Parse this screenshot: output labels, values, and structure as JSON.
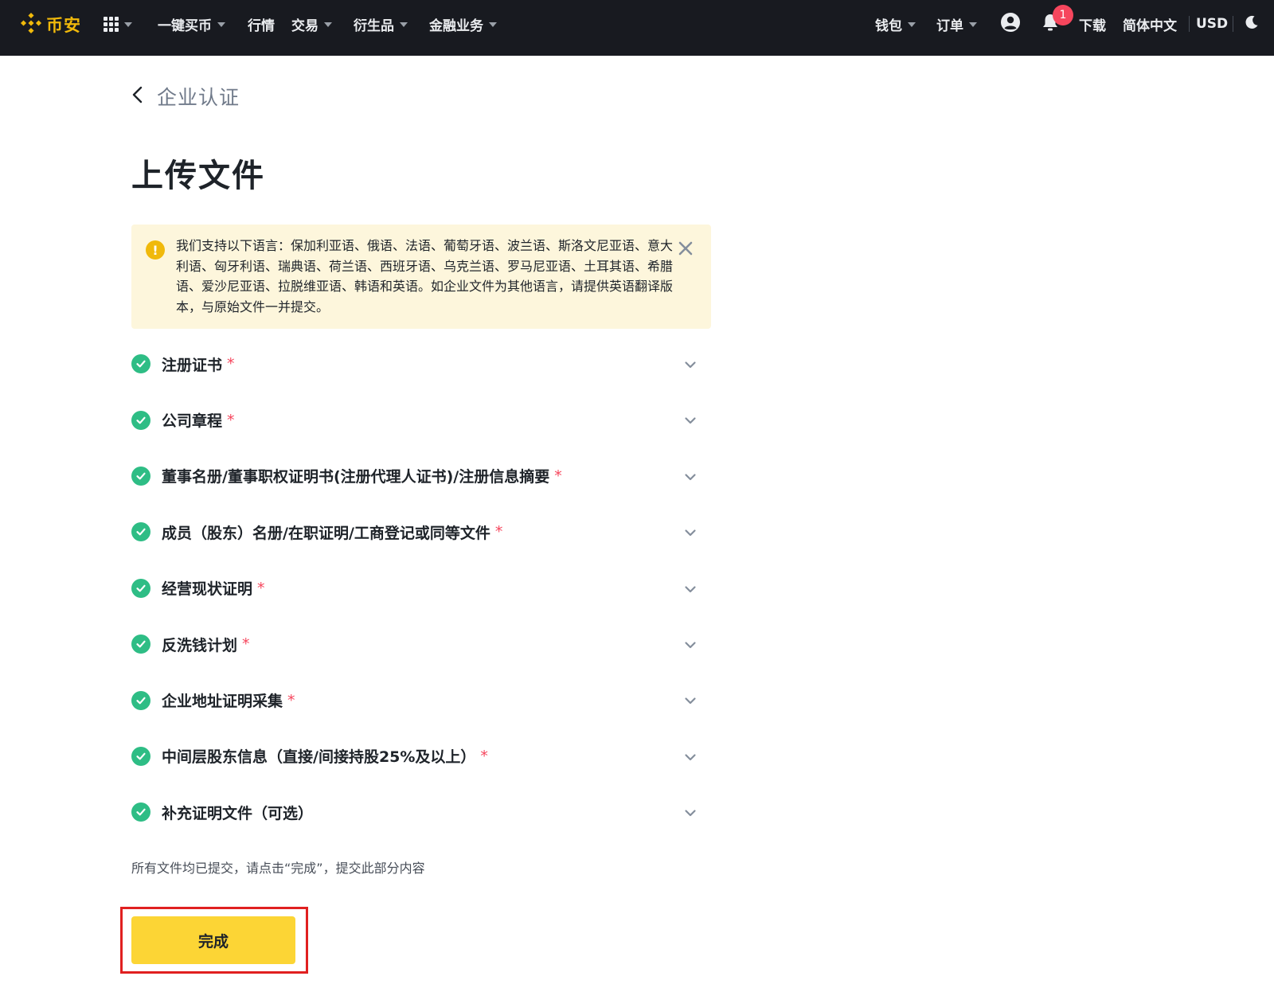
{
  "header": {
    "logo_text": "币安",
    "nav": [
      {
        "label": "一键买币",
        "has_dropdown": true
      },
      {
        "label": "行情",
        "has_dropdown": false
      },
      {
        "label": "交易",
        "has_dropdown": true
      },
      {
        "label": "衍生品",
        "has_dropdown": true
      },
      {
        "label": "金融业务",
        "has_dropdown": true
      }
    ],
    "right": {
      "wallet": "钱包",
      "orders": "订单",
      "notification_count": "1",
      "download": "下载",
      "language": "简体中文",
      "currency": "USD"
    }
  },
  "page": {
    "back_label": "企业认证",
    "title": "上传文件",
    "notice": "我们支持以下语言：保加利亚语、俄语、法语、葡萄牙语、波兰语、斯洛文尼亚语、意大利语、匈牙利语、瑞典语、荷兰语、西班牙语、乌克兰语、罗马尼亚语、土耳其语、希腊语、爱沙尼亚语、拉脱维亚语、韩语和英语。如企业文件为其他语言，请提供英语翻译版本，与原始文件一并提交。",
    "documents": [
      {
        "label": "注册证书",
        "required": "*"
      },
      {
        "label": "公司章程",
        "required": "*"
      },
      {
        "label": "董事名册/董事职权证明书(注册代理人证书)/注册信息摘要",
        "required": "*"
      },
      {
        "label": "成员（股东）名册/在职证明/工商登记或同等文件",
        "required": "*"
      },
      {
        "label": "经营现状证明",
        "required": "*"
      },
      {
        "label": "反洗钱计划",
        "required": "*"
      },
      {
        "label": "企业地址证明采集",
        "required": "*"
      },
      {
        "label": "中间层股东信息（直接/间接持股25%及以上）",
        "required": "*"
      },
      {
        "label": "补充证明文件（可选）",
        "required": ""
      }
    ],
    "hint": "所有文件均已提交，请点击“完成”，提交此部分内容",
    "done_button": "完成"
  },
  "colors": {
    "header_bg": "#181a20",
    "brand_yellow": "#f0b90b",
    "button_yellow": "#fcd535",
    "success_green": "#2ebd85",
    "required_red": "#f6465d",
    "notice_bg": "#fdf6dc"
  },
  "icons": [
    "binance-logo-icon",
    "apps-grid-icon",
    "user-icon",
    "bell-icon",
    "moon-icon",
    "back-arrow-icon",
    "warning-icon",
    "close-icon",
    "check-circle-icon",
    "chevron-down-icon"
  ]
}
